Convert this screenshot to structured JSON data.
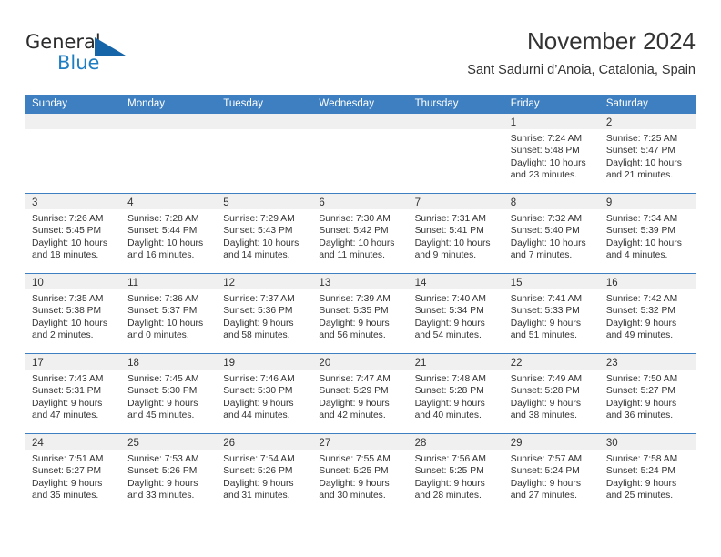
{
  "logo": {
    "word1": "General",
    "word2": "Blue",
    "icon": "triangle-logo-icon",
    "accent_color": "#1f7ec2"
  },
  "header": {
    "title": "November 2024",
    "subtitle": "Sant Sadurni d’Anoia, Catalonia, Spain"
  },
  "calendar": {
    "header_bg": "#3d7fc0",
    "daynum_bg": "#f0f0f0",
    "weekdays": [
      "Sunday",
      "Monday",
      "Tuesday",
      "Wednesday",
      "Thursday",
      "Friday",
      "Saturday"
    ],
    "weeks": [
      [
        {
          "day": "",
          "sunrise": "",
          "sunset": "",
          "daylight1": "",
          "daylight2": ""
        },
        {
          "day": "",
          "sunrise": "",
          "sunset": "",
          "daylight1": "",
          "daylight2": ""
        },
        {
          "day": "",
          "sunrise": "",
          "sunset": "",
          "daylight1": "",
          "daylight2": ""
        },
        {
          "day": "",
          "sunrise": "",
          "sunset": "",
          "daylight1": "",
          "daylight2": ""
        },
        {
          "day": "",
          "sunrise": "",
          "sunset": "",
          "daylight1": "",
          "daylight2": ""
        },
        {
          "day": "1",
          "sunrise": "Sunrise: 7:24 AM",
          "sunset": "Sunset: 5:48 PM",
          "daylight1": "Daylight: 10 hours",
          "daylight2": "and 23 minutes."
        },
        {
          "day": "2",
          "sunrise": "Sunrise: 7:25 AM",
          "sunset": "Sunset: 5:47 PM",
          "daylight1": "Daylight: 10 hours",
          "daylight2": "and 21 minutes."
        }
      ],
      [
        {
          "day": "3",
          "sunrise": "Sunrise: 7:26 AM",
          "sunset": "Sunset: 5:45 PM",
          "daylight1": "Daylight: 10 hours",
          "daylight2": "and 18 minutes."
        },
        {
          "day": "4",
          "sunrise": "Sunrise: 7:28 AM",
          "sunset": "Sunset: 5:44 PM",
          "daylight1": "Daylight: 10 hours",
          "daylight2": "and 16 minutes."
        },
        {
          "day": "5",
          "sunrise": "Sunrise: 7:29 AM",
          "sunset": "Sunset: 5:43 PM",
          "daylight1": "Daylight: 10 hours",
          "daylight2": "and 14 minutes."
        },
        {
          "day": "6",
          "sunrise": "Sunrise: 7:30 AM",
          "sunset": "Sunset: 5:42 PM",
          "daylight1": "Daylight: 10 hours",
          "daylight2": "and 11 minutes."
        },
        {
          "day": "7",
          "sunrise": "Sunrise: 7:31 AM",
          "sunset": "Sunset: 5:41 PM",
          "daylight1": "Daylight: 10 hours",
          "daylight2": "and 9 minutes."
        },
        {
          "day": "8",
          "sunrise": "Sunrise: 7:32 AM",
          "sunset": "Sunset: 5:40 PM",
          "daylight1": "Daylight: 10 hours",
          "daylight2": "and 7 minutes."
        },
        {
          "day": "9",
          "sunrise": "Sunrise: 7:34 AM",
          "sunset": "Sunset: 5:39 PM",
          "daylight1": "Daylight: 10 hours",
          "daylight2": "and 4 minutes."
        }
      ],
      [
        {
          "day": "10",
          "sunrise": "Sunrise: 7:35 AM",
          "sunset": "Sunset: 5:38 PM",
          "daylight1": "Daylight: 10 hours",
          "daylight2": "and 2 minutes."
        },
        {
          "day": "11",
          "sunrise": "Sunrise: 7:36 AM",
          "sunset": "Sunset: 5:37 PM",
          "daylight1": "Daylight: 10 hours",
          "daylight2": "and 0 minutes."
        },
        {
          "day": "12",
          "sunrise": "Sunrise: 7:37 AM",
          "sunset": "Sunset: 5:36 PM",
          "daylight1": "Daylight: 9 hours",
          "daylight2": "and 58 minutes."
        },
        {
          "day": "13",
          "sunrise": "Sunrise: 7:39 AM",
          "sunset": "Sunset: 5:35 PM",
          "daylight1": "Daylight: 9 hours",
          "daylight2": "and 56 minutes."
        },
        {
          "day": "14",
          "sunrise": "Sunrise: 7:40 AM",
          "sunset": "Sunset: 5:34 PM",
          "daylight1": "Daylight: 9 hours",
          "daylight2": "and 54 minutes."
        },
        {
          "day": "15",
          "sunrise": "Sunrise: 7:41 AM",
          "sunset": "Sunset: 5:33 PM",
          "daylight1": "Daylight: 9 hours",
          "daylight2": "and 51 minutes."
        },
        {
          "day": "16",
          "sunrise": "Sunrise: 7:42 AM",
          "sunset": "Sunset: 5:32 PM",
          "daylight1": "Daylight: 9 hours",
          "daylight2": "and 49 minutes."
        }
      ],
      [
        {
          "day": "17",
          "sunrise": "Sunrise: 7:43 AM",
          "sunset": "Sunset: 5:31 PM",
          "daylight1": "Daylight: 9 hours",
          "daylight2": "and 47 minutes."
        },
        {
          "day": "18",
          "sunrise": "Sunrise: 7:45 AM",
          "sunset": "Sunset: 5:30 PM",
          "daylight1": "Daylight: 9 hours",
          "daylight2": "and 45 minutes."
        },
        {
          "day": "19",
          "sunrise": "Sunrise: 7:46 AM",
          "sunset": "Sunset: 5:30 PM",
          "daylight1": "Daylight: 9 hours",
          "daylight2": "and 44 minutes."
        },
        {
          "day": "20",
          "sunrise": "Sunrise: 7:47 AM",
          "sunset": "Sunset: 5:29 PM",
          "daylight1": "Daylight: 9 hours",
          "daylight2": "and 42 minutes."
        },
        {
          "day": "21",
          "sunrise": "Sunrise: 7:48 AM",
          "sunset": "Sunset: 5:28 PM",
          "daylight1": "Daylight: 9 hours",
          "daylight2": "and 40 minutes."
        },
        {
          "day": "22",
          "sunrise": "Sunrise: 7:49 AM",
          "sunset": "Sunset: 5:28 PM",
          "daylight1": "Daylight: 9 hours",
          "daylight2": "and 38 minutes."
        },
        {
          "day": "23",
          "sunrise": "Sunrise: 7:50 AM",
          "sunset": "Sunset: 5:27 PM",
          "daylight1": "Daylight: 9 hours",
          "daylight2": "and 36 minutes."
        }
      ],
      [
        {
          "day": "24",
          "sunrise": "Sunrise: 7:51 AM",
          "sunset": "Sunset: 5:27 PM",
          "daylight1": "Daylight: 9 hours",
          "daylight2": "and 35 minutes."
        },
        {
          "day": "25",
          "sunrise": "Sunrise: 7:53 AM",
          "sunset": "Sunset: 5:26 PM",
          "daylight1": "Daylight: 9 hours",
          "daylight2": "and 33 minutes."
        },
        {
          "day": "26",
          "sunrise": "Sunrise: 7:54 AM",
          "sunset": "Sunset: 5:26 PM",
          "daylight1": "Daylight: 9 hours",
          "daylight2": "and 31 minutes."
        },
        {
          "day": "27",
          "sunrise": "Sunrise: 7:55 AM",
          "sunset": "Sunset: 5:25 PM",
          "daylight1": "Daylight: 9 hours",
          "daylight2": "and 30 minutes."
        },
        {
          "day": "28",
          "sunrise": "Sunrise: 7:56 AM",
          "sunset": "Sunset: 5:25 PM",
          "daylight1": "Daylight: 9 hours",
          "daylight2": "and 28 minutes."
        },
        {
          "day": "29",
          "sunrise": "Sunrise: 7:57 AM",
          "sunset": "Sunset: 5:24 PM",
          "daylight1": "Daylight: 9 hours",
          "daylight2": "and 27 minutes."
        },
        {
          "day": "30",
          "sunrise": "Sunrise: 7:58 AM",
          "sunset": "Sunset: 5:24 PM",
          "daylight1": "Daylight: 9 hours",
          "daylight2": "and 25 minutes."
        }
      ]
    ]
  }
}
